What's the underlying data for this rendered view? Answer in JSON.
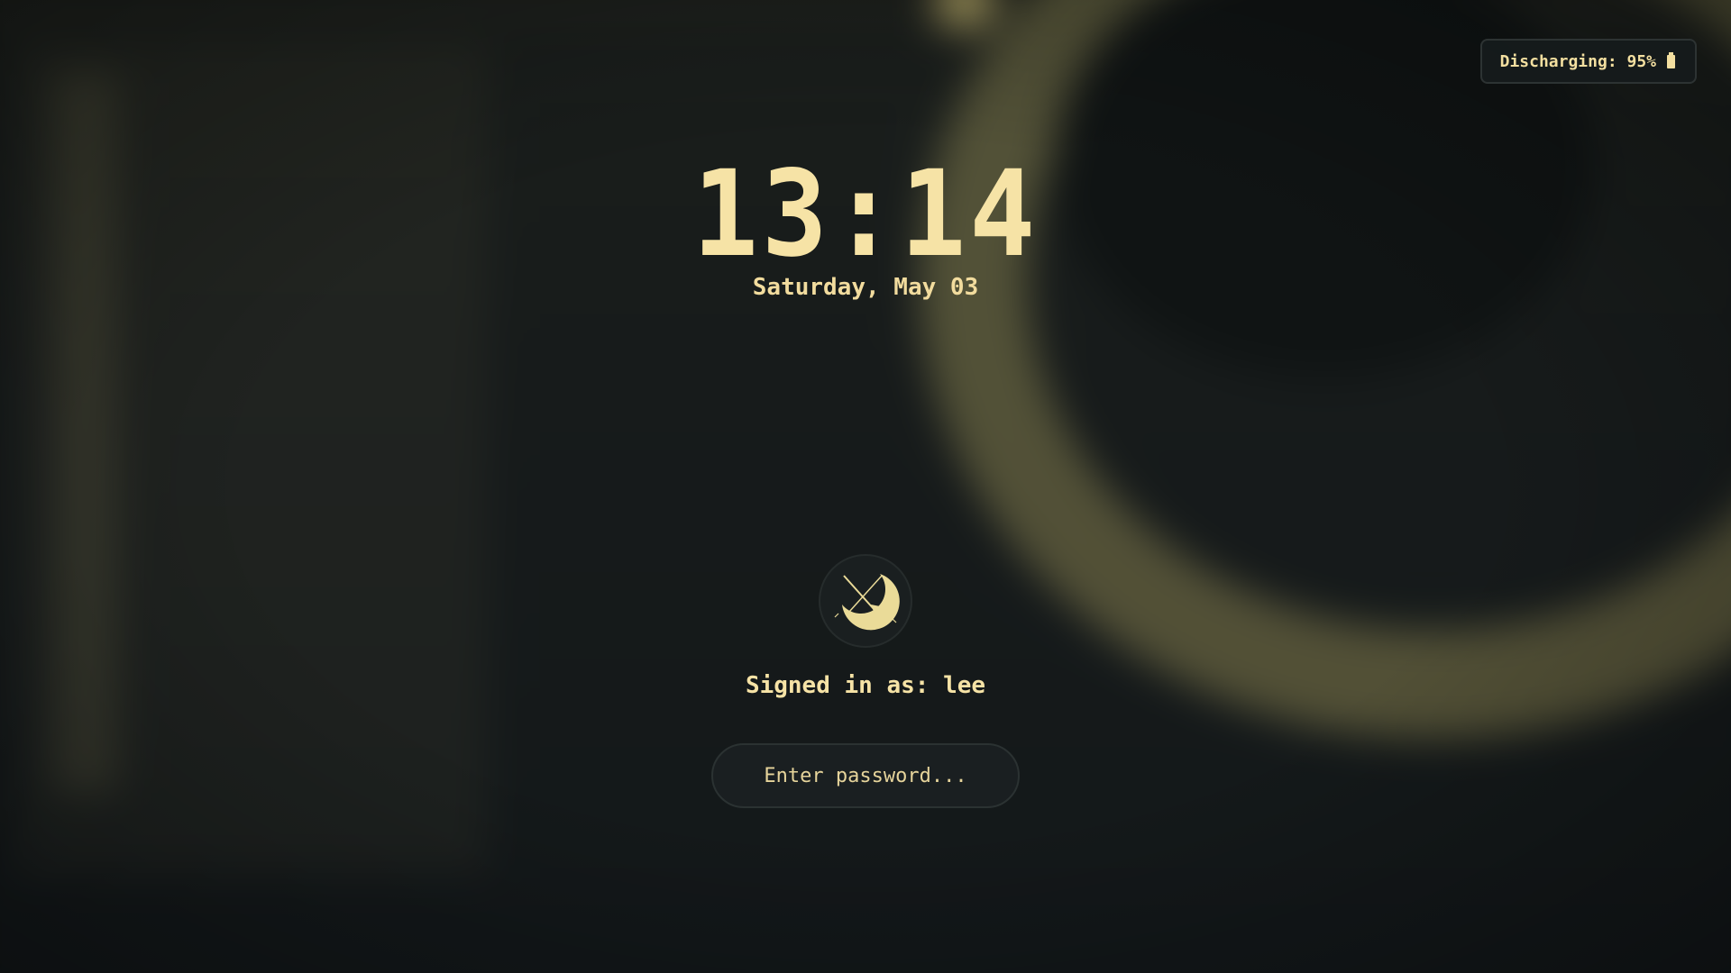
{
  "battery": {
    "label": "Discharging: 95%",
    "icon": "battery-icon"
  },
  "clock": {
    "time": "13:14",
    "date": "Saturday, May 03"
  },
  "user": {
    "avatar_icon": "crescent-moon-avatar-icon",
    "signed_in_text": "Signed in as: lee"
  },
  "password": {
    "placeholder": "Enter password...",
    "value": ""
  },
  "colors": {
    "accent": "#f6e3a6",
    "background": "#151a1b",
    "panel": "#1a1f21",
    "border": "#2b3232"
  }
}
